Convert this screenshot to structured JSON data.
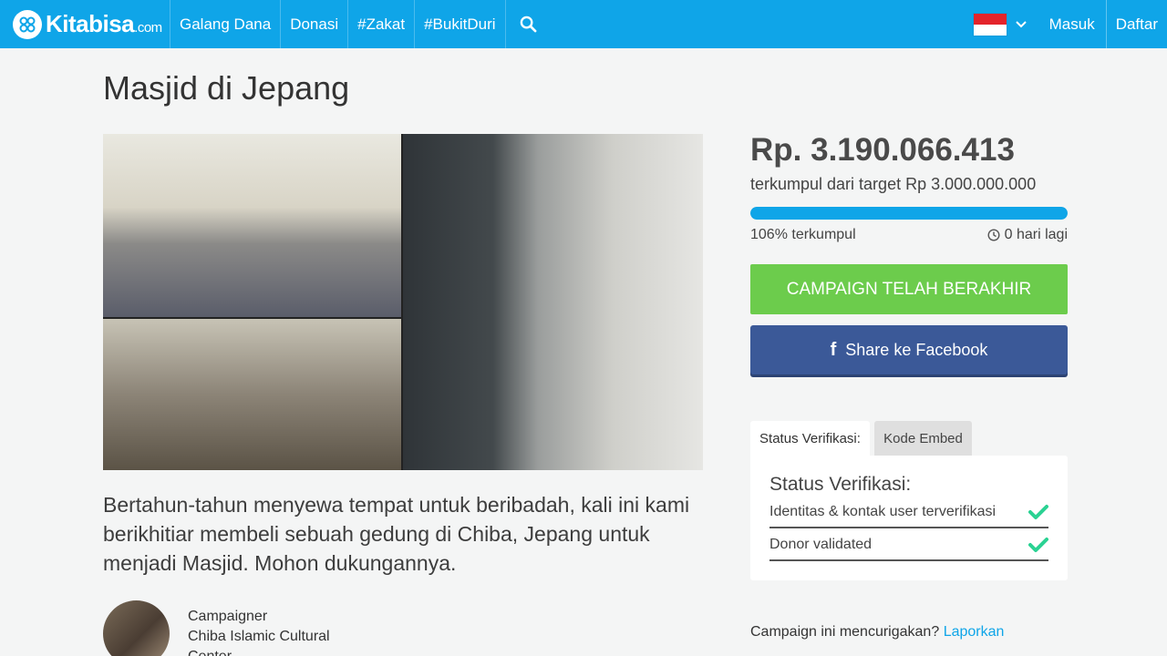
{
  "nav": {
    "logo_text": "Kitabisa",
    "logo_domain": ".com",
    "items": [
      "Galang Dana",
      "Donasi",
      "#Zakat",
      "#BukitDuri"
    ],
    "login": "Masuk",
    "register": "Daftar",
    "brand_color": "#0fa5e8"
  },
  "campaign": {
    "title": "Masjid di Jepang",
    "description": "Bertahun-tahun menyewa tempat untuk beribadah, kali ini kami berikhitiar membeli sebuah gedung di Chiba, Jepang untuk menjadi Masjid. Mohon dukungannya.",
    "campaigner_label": "Campaigner",
    "campaigner_name": "Chiba Islamic Cultural Center"
  },
  "funding": {
    "amount": "Rp. 3.190.066.413",
    "target_text": "terkumpul dari target Rp 3.000.000.000",
    "progress_fraction": 1.0,
    "percent_text": "106% terkumpul",
    "days_left": "0 hari lagi"
  },
  "actions": {
    "ended_label": "CAMPAIGN TELAH BERAKHIR",
    "facebook_label": "Share ke Facebook"
  },
  "tabs": {
    "verification": "Status Verifikasi:",
    "embed": "Kode Embed"
  },
  "verification": {
    "title": "Status Verifikasi:",
    "items": [
      "Identitas & kontak user terverifikasi",
      "Donor validated"
    ]
  },
  "report": {
    "question": "Campaign ini mencurigakan?",
    "link": "Laporkan"
  }
}
